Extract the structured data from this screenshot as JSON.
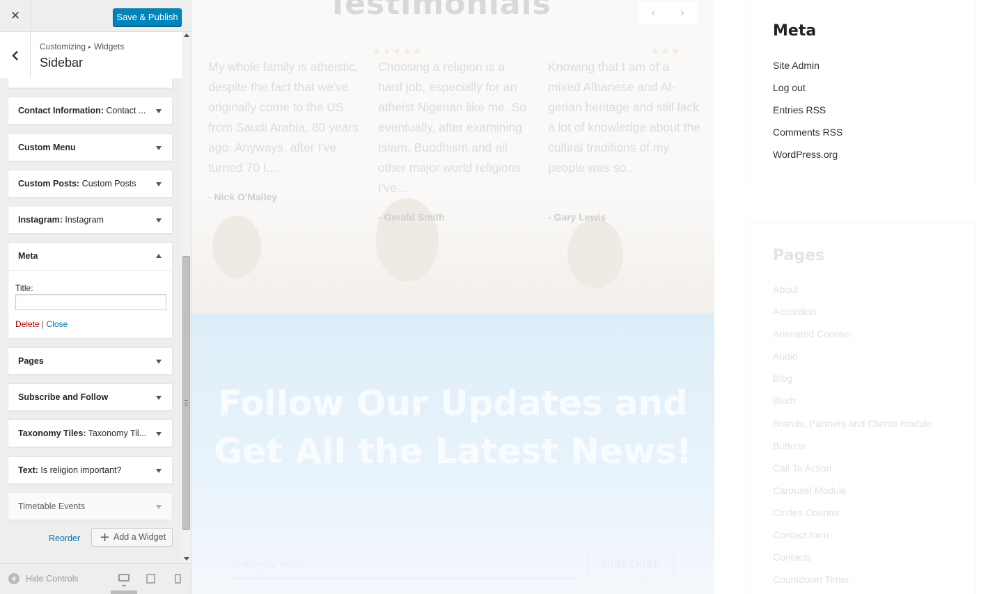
{
  "customizer": {
    "close_glyph": "✕",
    "save_label": "Save & Publish",
    "breadcrumb": {
      "parent": "Customizing",
      "separator": "▸",
      "current": "Widgets"
    },
    "section_title": "Sidebar",
    "widgets": [
      {
        "name": "Contact Information:",
        "subtitle": " Contact ...",
        "expanded": false
      },
      {
        "name": "Custom Menu",
        "subtitle": "",
        "expanded": false
      },
      {
        "name": "Custom Posts:",
        "subtitle": " Custom Posts",
        "expanded": false
      },
      {
        "name": "Instagram:",
        "subtitle": " Instagram",
        "expanded": false
      },
      {
        "name": "Meta",
        "subtitle": "",
        "expanded": true
      },
      {
        "name": "Pages",
        "subtitle": "",
        "expanded": false
      },
      {
        "name": "Subscribe and Follow",
        "subtitle": "",
        "expanded": false
      },
      {
        "name": "Taxonomy Tiles:",
        "subtitle": " Taxonomy Til...",
        "expanded": false
      },
      {
        "name": "Text:",
        "subtitle": " Is religion important?",
        "expanded": false
      },
      {
        "name": "Timetable Events",
        "subtitle": "",
        "expanded": false,
        "disabled": true
      }
    ],
    "meta_form": {
      "title_label": "Title:",
      "title_value": "",
      "delete_label": "Delete",
      "separator": " | ",
      "close_label": "Close"
    },
    "reorder_label": "Reorder",
    "add_widget_label": "Add a Widget",
    "footer": {
      "hide_controls_label": "Hide Controls",
      "active_device": "desktop"
    }
  },
  "preview": {
    "testimonials": {
      "heading": "Testimonials",
      "items": [
        {
          "text": "My whole family is athe­is­tic, despite the fact that we've originally come to the US from Saudi Arabia, 80 years ago. Anyways, after I've turned 70 I...",
          "author": "- Nick O'Malley"
        },
        {
          "text": "Choosing a religion is a hard job, especially for an atheist Nigerian like me. So eventually, after examining Islam, Buddhism and all other major world religions I've...",
          "author": "- Gerald Smith"
        },
        {
          "text": "Knowing that I am of a mixed Albanese and Al­gerian heritage and still lack a lot of knowledge about the cultiral tradi­tions of my people was so...",
          "author": "- Gary Lewis"
        }
      ]
    },
    "subscribe": {
      "heading": "Follow Our Updates and Get All the Latest News!",
      "email_placeholder": "Enter your email",
      "button_label": "SUBSCRIBE"
    },
    "meta_sidebar": {
      "title": "Meta",
      "links": [
        "Site Admin",
        "Log out",
        "Entries RSS",
        "Comments RSS",
        "WordPress.org"
      ]
    },
    "pages_sidebar": {
      "title": "Pages",
      "links": [
        "About",
        "Accordion",
        "Animated Counter",
        "Audio",
        "Blog",
        "Blurb",
        "Brands, Partners and Clients module",
        "Buttons",
        "Call To Action",
        "Carousel Module",
        "Circles Counter",
        "Contact form",
        "Contacts",
        "Countdown Timer"
      ]
    }
  },
  "colors": {
    "primary_button": "#0085ba",
    "link": "#0073aa",
    "delete": "#aa0000"
  }
}
